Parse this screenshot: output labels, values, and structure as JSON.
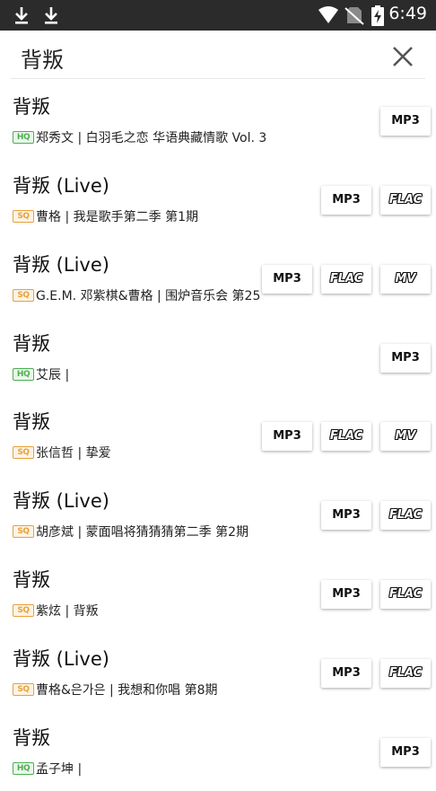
{
  "status_bar": {
    "time": "6:49",
    "icons": [
      "download-icon",
      "download-icon",
      "wifi-icon",
      "no-sim-icon",
      "battery-charging-icon"
    ]
  },
  "search": {
    "query": "背叛"
  },
  "results": [
    {
      "title": "背叛",
      "quality": "HQ",
      "info": "郑秀文 | 白羽毛之恋 华语典藏情歌 Vol. 3",
      "buttons": [
        "MP3"
      ]
    },
    {
      "title": "背叛 (Live)",
      "quality": "SQ",
      "info": "曹格 | 我是歌手第二季 第1期",
      "buttons": [
        "MP3",
        "FLAC"
      ]
    },
    {
      "title": "背叛 (Live)",
      "quality": "SQ",
      "info": "G.E.M. 邓紫棋&曹格 | 围炉音乐会 第25",
      "buttons": [
        "MP3",
        "FLAC",
        "MV"
      ]
    },
    {
      "title": "背叛",
      "quality": "HQ",
      "info": "艾辰 |",
      "buttons": [
        "MP3"
      ]
    },
    {
      "title": "背叛",
      "quality": "SQ",
      "info": "张信哲 | 挚爱",
      "buttons": [
        "MP3",
        "FLAC",
        "MV"
      ]
    },
    {
      "title": "背叛 (Live)",
      "quality": "SQ",
      "info": "胡彦斌 | 蒙面唱将猜猜猜第二季 第2期",
      "buttons": [
        "MP3",
        "FLAC"
      ]
    },
    {
      "title": "背叛",
      "quality": "SQ",
      "info": "紫炫 | 背叛",
      "buttons": [
        "MP3",
        "FLAC"
      ]
    },
    {
      "title": "背叛 (Live)",
      "quality": "SQ",
      "info": "曹格&은가은 | 我想和你唱 第8期",
      "buttons": [
        "MP3",
        "FLAC"
      ]
    },
    {
      "title": "背叛",
      "quality": "HQ",
      "info": "孟子坤 |",
      "buttons": [
        "MP3"
      ]
    }
  ],
  "colors": {
    "status_bar": "#2b2b2b",
    "hq_badge": "#4caf50",
    "sq_badge": "#e6a23c"
  }
}
